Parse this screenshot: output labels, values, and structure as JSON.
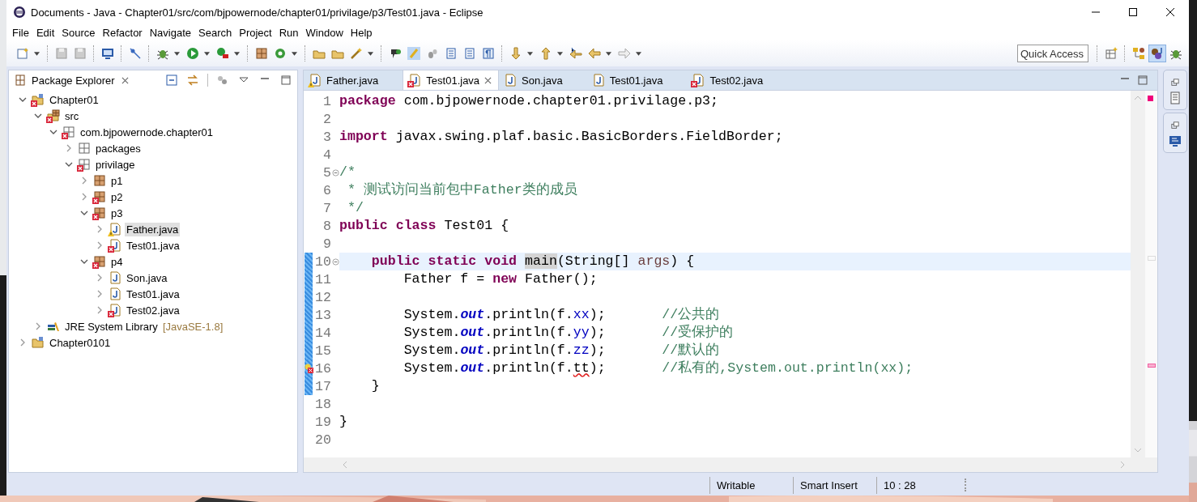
{
  "window": {
    "title": "Documents - Java - Chapter01/src/com/bjpowernode/chapter01/privilage/p3/Test01.java - Eclipse"
  },
  "menu": [
    "File",
    "Edit",
    "Source",
    "Refactor",
    "Navigate",
    "Search",
    "Project",
    "Run",
    "Window",
    "Help"
  ],
  "toolbar": {
    "quick_access": {
      "placeholder": "Quick Access"
    }
  },
  "package_explorer": {
    "title": "Package Explorer",
    "tree": [
      {
        "label": "Chapter01",
        "kind": "project",
        "error": true,
        "warning": false,
        "expanded": true,
        "selected": false,
        "children": [
          {
            "label": "src",
            "kind": "source_folder",
            "error": true,
            "warning": false,
            "expanded": true,
            "selected": false,
            "children": [
              {
                "label": "com.bjpowernode.chapter01",
                "kind": "empty_package",
                "error": true,
                "warning": false,
                "expanded": true,
                "selected": false,
                "children": [
                  {
                    "label": "packages",
                    "kind": "empty_package",
                    "error": false,
                    "warning": false,
                    "expanded": false,
                    "selected": false
                  },
                  {
                    "label": "privilage",
                    "kind": "empty_package",
                    "error": true,
                    "warning": false,
                    "expanded": true,
                    "selected": false,
                    "children": [
                      {
                        "label": "p1",
                        "kind": "package",
                        "error": false,
                        "warning": false,
                        "expanded": false,
                        "selected": false
                      },
                      {
                        "label": "p2",
                        "kind": "package",
                        "error": true,
                        "warning": false,
                        "expanded": false,
                        "selected": false
                      },
                      {
                        "label": "p3",
                        "kind": "package",
                        "error": true,
                        "warning": false,
                        "expanded": true,
                        "selected": false,
                        "children": [
                          {
                            "label": "Father.java",
                            "kind": "java_file",
                            "error": false,
                            "warning": true,
                            "expanded": false,
                            "selected": true
                          },
                          {
                            "label": "Test01.java",
                            "kind": "java_file",
                            "error": true,
                            "warning": false,
                            "expanded": false,
                            "selected": false
                          }
                        ]
                      },
                      {
                        "label": "p4",
                        "kind": "package",
                        "error": true,
                        "warning": false,
                        "expanded": true,
                        "selected": false,
                        "children": [
                          {
                            "label": "Son.java",
                            "kind": "java_file",
                            "error": false,
                            "warning": false,
                            "expanded": false,
                            "selected": false
                          },
                          {
                            "label": "Test01.java",
                            "kind": "java_file",
                            "error": false,
                            "warning": false,
                            "expanded": false,
                            "selected": false
                          },
                          {
                            "label": "Test02.java",
                            "kind": "java_file",
                            "error": true,
                            "warning": false,
                            "expanded": false,
                            "selected": false
                          }
                        ]
                      }
                    ]
                  }
                ]
              }
            ]
          },
          {
            "label": "JRE System Library",
            "note": "[JavaSE-1.8]",
            "kind": "library",
            "error": false,
            "warning": false,
            "expanded": false,
            "selected": false
          }
        ]
      },
      {
        "label": "Chapter0101",
        "kind": "project",
        "error": false,
        "warning": false,
        "expanded": false,
        "selected": false
      }
    ]
  },
  "editor": {
    "tabs": [
      {
        "label": "Father.java",
        "error": false,
        "warning": true,
        "selected": false
      },
      {
        "label": "Test01.java",
        "error": true,
        "warning": false,
        "selected": true
      },
      {
        "label": "Son.java",
        "error": false,
        "warning": false,
        "selected": false
      },
      {
        "label": "Test01.java",
        "error": false,
        "warning": false,
        "selected": false
      },
      {
        "label": "Test02.java",
        "error": true,
        "warning": false,
        "selected": false
      }
    ],
    "lines": [
      {
        "number": "1",
        "changed": false,
        "current": false,
        "tokens": [
          {
            "kind": "keyword",
            "text": "package"
          },
          {
            "kind": "text",
            "text": " com.bjpowernode.chapter01.privilage.p3;"
          }
        ]
      },
      {
        "number": "2",
        "changed": false,
        "current": false
      },
      {
        "number": "3",
        "changed": false,
        "current": false,
        "tokens": [
          {
            "kind": "keyword",
            "text": "import"
          },
          {
            "kind": "text",
            "text": " javax.swing.plaf.basic.BasicBorders.FieldBorder;"
          }
        ]
      },
      {
        "number": "4",
        "changed": false,
        "current": false
      },
      {
        "number": "5",
        "changed": false,
        "current": false,
        "fold": true,
        "tokens": [
          {
            "kind": "comment",
            "text": "/*"
          }
        ]
      },
      {
        "number": "6",
        "changed": false,
        "current": false,
        "tokens": [
          {
            "kind": "comment",
            "text": " * 测试访问当前包中Father类的成员"
          }
        ]
      },
      {
        "number": "7",
        "changed": false,
        "current": false,
        "tokens": [
          {
            "kind": "comment",
            "text": " */"
          }
        ]
      },
      {
        "number": "8",
        "changed": false,
        "current": false,
        "tokens": [
          {
            "kind": "keyword",
            "text": "public class"
          },
          {
            "kind": "text",
            "text": " Test01 {"
          }
        ]
      },
      {
        "number": "9",
        "changed": false,
        "current": false
      },
      {
        "number": "10",
        "changed": true,
        "current": true,
        "fold": true,
        "tokens": [
          {
            "kind": "keyword",
            "text": "    public static void "
          },
          {
            "kind": "occurrence",
            "text": "main"
          },
          {
            "kind": "text",
            "text": "(String[] "
          },
          {
            "kind": "param",
            "text": "args"
          },
          {
            "kind": "text",
            "text": ") {"
          }
        ]
      },
      {
        "number": "11",
        "changed": true,
        "current": false,
        "tokens": [
          {
            "kind": "text",
            "text": "        Father f = "
          },
          {
            "kind": "keyword",
            "text": "new"
          },
          {
            "kind": "text",
            "text": " Father();"
          }
        ]
      },
      {
        "number": "12",
        "changed": true,
        "current": false
      },
      {
        "number": "13",
        "changed": true,
        "current": false,
        "tokens": [
          {
            "kind": "text",
            "text": "        System."
          },
          {
            "kind": "static",
            "text": "out"
          },
          {
            "kind": "text",
            "text": ".println(f."
          },
          {
            "kind": "field",
            "text": "xx"
          },
          {
            "kind": "text",
            "text": ");       "
          },
          {
            "kind": "comment",
            "text": "//公共的"
          }
        ]
      },
      {
        "number": "14",
        "changed": true,
        "current": false,
        "tokens": [
          {
            "kind": "text",
            "text": "        System."
          },
          {
            "kind": "static",
            "text": "out"
          },
          {
            "kind": "text",
            "text": ".println(f."
          },
          {
            "kind": "field",
            "text": "yy"
          },
          {
            "kind": "text",
            "text": ");       "
          },
          {
            "kind": "comment",
            "text": "//受保护的"
          }
        ]
      },
      {
        "number": "15",
        "changed": true,
        "current": false,
        "tokens": [
          {
            "kind": "text",
            "text": "        System."
          },
          {
            "kind": "static",
            "text": "out"
          },
          {
            "kind": "text",
            "text": ".println(f."
          },
          {
            "kind": "field",
            "text": "zz"
          },
          {
            "kind": "text",
            "text": ");       "
          },
          {
            "kind": "comment",
            "text": "//默认的"
          }
        ]
      },
      {
        "number": "16",
        "changed": true,
        "current": false,
        "error": true,
        "tokens": [
          {
            "kind": "text",
            "text": "        System."
          },
          {
            "kind": "static",
            "text": "out"
          },
          {
            "kind": "text",
            "text": ".println(f."
          },
          {
            "kind": "error",
            "text": "tt"
          },
          {
            "kind": "text",
            "text": ");       "
          },
          {
            "kind": "comment",
            "text": "//私有的,System.out.println(xx);"
          }
        ]
      },
      {
        "number": "17",
        "changed": true,
        "current": false,
        "tokens": [
          {
            "kind": "text",
            "text": "    }"
          }
        ]
      },
      {
        "number": "18",
        "changed": false,
        "current": false
      },
      {
        "number": "19",
        "changed": false,
        "current": false,
        "tokens": [
          {
            "kind": "text",
            "text": "}"
          }
        ]
      },
      {
        "number": "20",
        "changed": false,
        "current": false
      }
    ]
  },
  "status_bar": [
    "Writable",
    "Smart Insert",
    "10 : 28"
  ]
}
